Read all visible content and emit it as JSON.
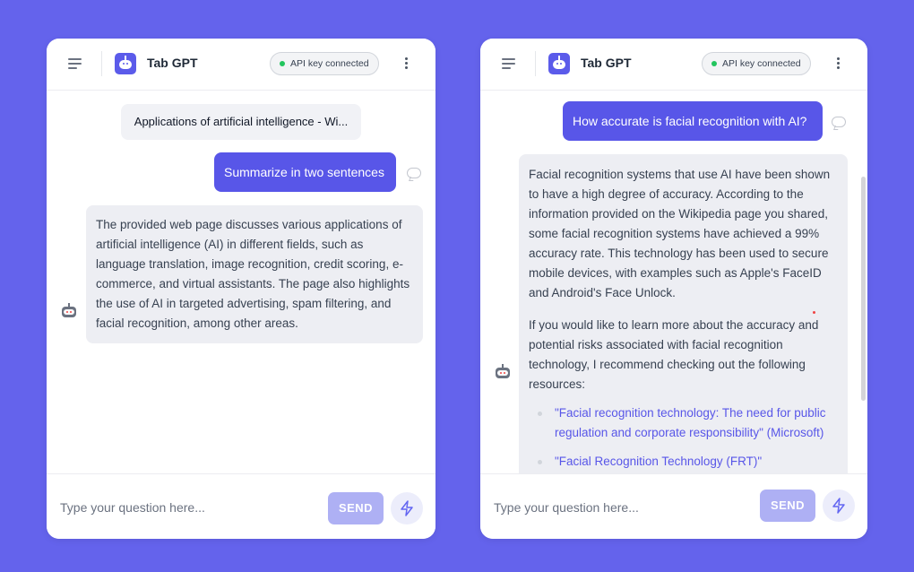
{
  "colors": {
    "background": "#6463ec",
    "accent": "#5856e8",
    "status": "#22c55e"
  },
  "icons": [
    "menu-icon",
    "robot-logo-icon",
    "status-dot-icon",
    "more-vertical-icon",
    "comment-icon",
    "bot-avatar-icon",
    "bolt-icon"
  ],
  "left_panel": {
    "app_title": "Tab GPT",
    "api_status": "API key connected",
    "context_chip": "Applications of artificial intelligence - Wi...",
    "user_message": "Summarize in two sentences",
    "bot_message": "The provided web page discusses various applications of artificial intelligence (AI) in different fields, such as language translation, image recognition, credit scoring, e-commerce, and virtual assistants. The page also highlights the use of AI in targeted advertising, spam filtering, and facial recognition, among other areas.",
    "input_placeholder": "Type your question here...",
    "send_label": "SEND"
  },
  "right_panel": {
    "app_title": "Tab GPT",
    "api_status": "API key connected",
    "user_message": "How accurate is facial recognition with AI?",
    "bot_paragraph_1": "Facial recognition systems that use AI have been shown to have a high degree of accuracy. According to the information provided on the Wikipedia page you shared, some facial recognition systems have achieved a 99% accuracy rate. This technology has been used to secure mobile devices, with examples such as Apple's FaceID and Android's Face Unlock.",
    "bot_paragraph_2": "If you would like to learn more about the accuracy and potential risks associated with facial recognition technology, I recommend checking out the following resources:",
    "resources": [
      "\"Facial recognition technology: The need for public regulation and corporate responsibility\" (Microsoft)",
      "\"Facial Recognition Technology (FRT)\""
    ],
    "input_placeholder": "Type your question here...",
    "send_label": "SEND"
  }
}
